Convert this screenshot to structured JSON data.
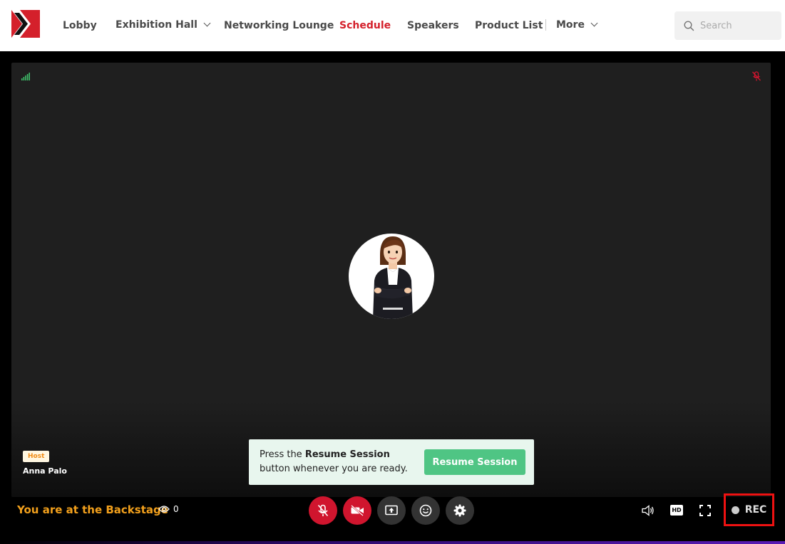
{
  "nav": {
    "items": [
      {
        "label": "Lobby"
      },
      {
        "label": "Exhibition Hall"
      },
      {
        "label": "Networking Lounge"
      },
      {
        "label": "Schedule"
      },
      {
        "label": "Speakers"
      },
      {
        "label": "Product List"
      },
      {
        "label": "More"
      }
    ],
    "active": "Schedule",
    "search_placeholder": "Search"
  },
  "stage": {
    "participant": {
      "role_badge": "Host",
      "name": "Anna Palo"
    },
    "toast": {
      "prefix": "Press the ",
      "bold": "Resume Session",
      "suffix": "button whenever you are ready.",
      "button_label": "Resume Session"
    }
  },
  "controls": {
    "status": "You are at the Backstage",
    "viewer_count": "0",
    "rec_label": "REC",
    "hd_label": "HD"
  },
  "colors": {
    "accent_red": "#d4202b",
    "status_orange": "#f2a01c",
    "resume_green": "#4fc584",
    "rec_highlight": "#ee1111"
  },
  "icons": [
    "signal-icon",
    "mic-off-icon",
    "camera-off-icon",
    "share-screen-icon",
    "emoji-icon",
    "settings-icon",
    "volume-icon",
    "hd-icon",
    "fullscreen-icon",
    "search-icon",
    "eye-icon"
  ]
}
